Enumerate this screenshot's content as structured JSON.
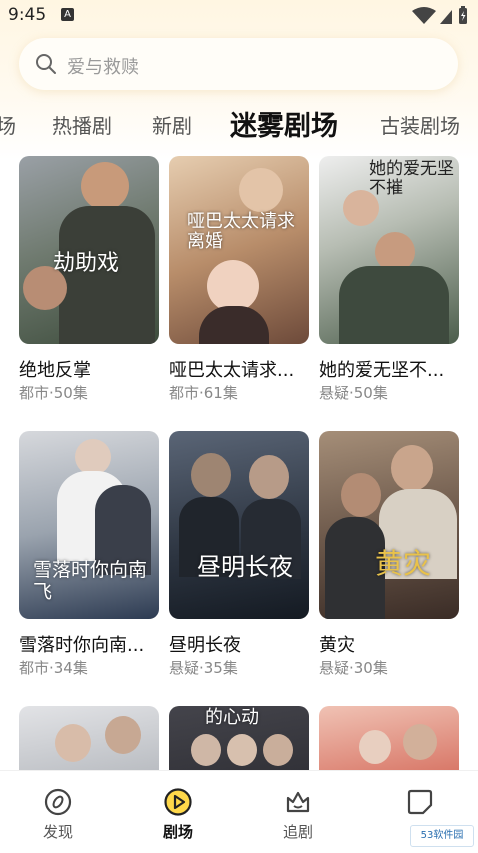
{
  "status_bar": {
    "time": "9:45",
    "notification_letter": "A"
  },
  "search": {
    "placeholder": "爱与救赎"
  },
  "tabs": [
    {
      "label": "场"
    },
    {
      "label": "热播剧"
    },
    {
      "label": "新剧"
    },
    {
      "label": "迷雾剧场",
      "active": true
    },
    {
      "label": "古装剧场"
    }
  ],
  "dramas": [
    {
      "title": "绝地反掌",
      "meta": "都市·50集",
      "poster_text": "劫助戏",
      "colors": [
        "#8a8f96",
        "#3d4c3c"
      ]
    },
    {
      "title": "哑巴太太请求...",
      "meta": "都市·61集",
      "poster_text": "哑巴太太请求离婚",
      "colors": [
        "#caa98a",
        "#6d4a3a"
      ]
    },
    {
      "title": "她的爱无坚不...",
      "meta": "悬疑·50集",
      "poster_text": "她的爱无坚不摧",
      "colors": [
        "#d8d8d8",
        "#4b5d4b"
      ]
    },
    {
      "title": "雪落时你向南...",
      "meta": "都市·34集",
      "poster_text": "雪落时你向南飞",
      "colors": [
        "#c9ccd2",
        "#2d3b52"
      ]
    },
    {
      "title": "昼明长夜",
      "meta": "悬疑·35集",
      "poster_text": "昼明长夜",
      "colors": [
        "#4b5666",
        "#141a22"
      ]
    },
    {
      "title": "黄灾",
      "meta": "悬疑·30集",
      "poster_text": "黄灾",
      "colors": [
        "#8b7460",
        "#3a2c26"
      ]
    },
    {
      "title": "",
      "meta": "",
      "poster_text": "",
      "colors": [
        "#d9d9dc",
        "#5b5f66"
      ]
    },
    {
      "title": "",
      "meta": "",
      "poster_text": "的心动",
      "colors": [
        "#3a3a40",
        "#1c1c22"
      ]
    },
    {
      "title": "",
      "meta": "",
      "poster_text": "",
      "colors": [
        "#e8a090",
        "#b03a30"
      ]
    }
  ],
  "bottom_nav": [
    {
      "label": "发现",
      "icon": "compass-icon"
    },
    {
      "label": "剧场",
      "icon": "play-icon",
      "active": true
    },
    {
      "label": "追剧",
      "icon": "crown-icon"
    },
    {
      "label": "",
      "icon": "square-icon"
    }
  ],
  "watermark": "53软件园"
}
